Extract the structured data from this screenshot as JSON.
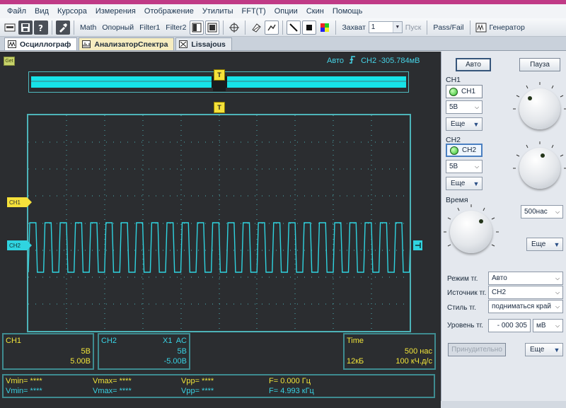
{
  "menu": [
    "Файл",
    "Вид",
    "Курсора",
    "Измерения",
    "Отображение",
    "Утилиты",
    "FFT(T)",
    "Опции",
    "Скин",
    "Помощь"
  ],
  "toolbar": {
    "math": "Math",
    "reference": "Опорный",
    "filter1": "Filter1",
    "filter2": "Filter2",
    "capture_label": "Захват",
    "capture_value": "1",
    "start": "Пуск",
    "passfail": "Pass/Fail",
    "generator": "Генератор"
  },
  "tabs": [
    {
      "label": "Осциллограф"
    },
    {
      "label": "АнализаторСпектра"
    },
    {
      "label": "Lissajous"
    }
  ],
  "scope": {
    "get_icon": "Get",
    "status_mode": "Авто",
    "status_channel": "CH2",
    "status_value": "-305.784мВ",
    "trigger_marker": "T",
    "ch1_marker": "CH1",
    "ch2_marker": "CH2",
    "colors": {
      "ch1": "#f5e13a",
      "ch2": "#2fd4e0",
      "grid": "#4db3b8",
      "background": "#2b2d30"
    }
  },
  "info": {
    "ch1": {
      "name": "CH1",
      "scale": "5В",
      "offset": "5.00В"
    },
    "ch2": {
      "name": "CH2",
      "probe": "X1",
      "coupling": "AC",
      "scale": "5В",
      "offset": "-5.00В"
    },
    "time": {
      "name": "Time",
      "scale": "500 нас",
      "memory": "12кБ",
      "rate": "100 кЧ.д/с"
    }
  },
  "measurements": {
    "ch1": {
      "vmin": "Vmin= ****",
      "vmax": "Vmax= ****",
      "vpp": "Vpp= ****",
      "freq": "F= 0.000 Гц"
    },
    "ch2": {
      "vmin": "Vmin= ****",
      "vmax": "Vmax= ****",
      "vpp": "Vpp= ****",
      "freq": "F= 4.993 кГц"
    }
  },
  "panel": {
    "auto_button": "Авто",
    "pause_button": "Пауза",
    "ch1_section": "CH1",
    "ch1_button": "CH1",
    "ch1_scale": "5В",
    "ch1_more": "Еще",
    "ch2_section": "CH2",
    "ch2_button": "CH2",
    "ch2_scale": "5В",
    "ch2_more": "Еще",
    "time_section": "Время",
    "time_scale": "500нас",
    "time_more": "Еще",
    "trigger_mode_label": "Режим тг.",
    "trigger_mode": "Авто",
    "trigger_source_label": "Источник тг.",
    "trigger_source": "CH2",
    "trigger_style_label": "Стиль тг.",
    "trigger_style": "подниматься край",
    "trigger_level_label": "Уровень тг.",
    "trigger_level": "- 000 305",
    "trigger_level_unit": "мВ",
    "force_button": "Принудительно",
    "trigger_more": "Еще"
  }
}
